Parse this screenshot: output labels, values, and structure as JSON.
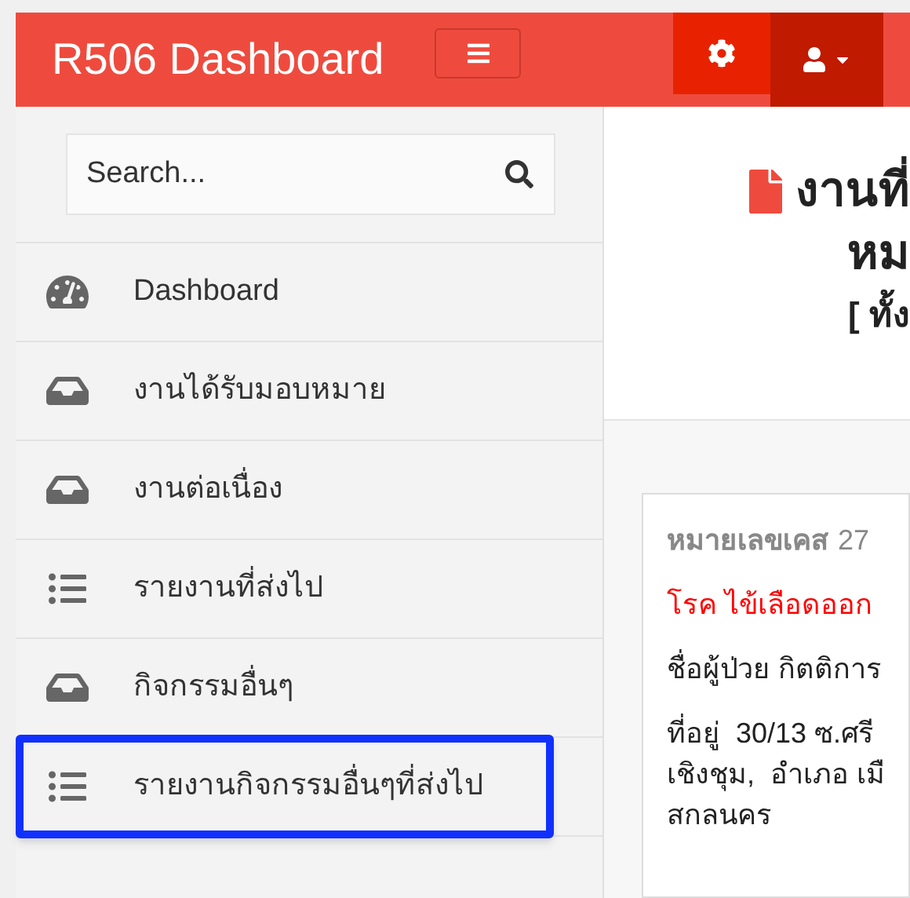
{
  "navbar": {
    "brand": "R506 Dashboard"
  },
  "sidebar": {
    "search": {
      "placeholder": "Search..."
    },
    "items": [
      {
        "label": "Dashboard",
        "kind": "gauge",
        "highlighted": false
      },
      {
        "label": "งานได้รับมอบหมาย",
        "kind": "inbox",
        "highlighted": false
      },
      {
        "label": "งานต่อเนื่อง",
        "kind": "inbox",
        "highlighted": false
      },
      {
        "label": "รายงานที่ส่งไป",
        "kind": "list",
        "highlighted": false
      },
      {
        "label": "กิจกรรมอื่นๆ",
        "kind": "inbox",
        "highlighted": false
      },
      {
        "label": "รายงานกิจกรรมอื่นๆที่ส่งไป",
        "kind": "list",
        "highlighted": true
      }
    ]
  },
  "main": {
    "title_lines": [
      "งานที่",
      "หม"
    ],
    "subtitle": "[ ทั้ง",
    "card": {
      "case_label": "หมายเลขเคส",
      "case_number": "27",
      "disease": "โรค ไข้เลือดออก",
      "patient": "ชื่อผู้ป่วย กิตติการ",
      "address_lines": [
        "ที่อยู่  30/13 ซ.ศรี",
        "เชิงชุม,  อำเภอ เมื",
        "สกลนคร"
      ]
    }
  }
}
